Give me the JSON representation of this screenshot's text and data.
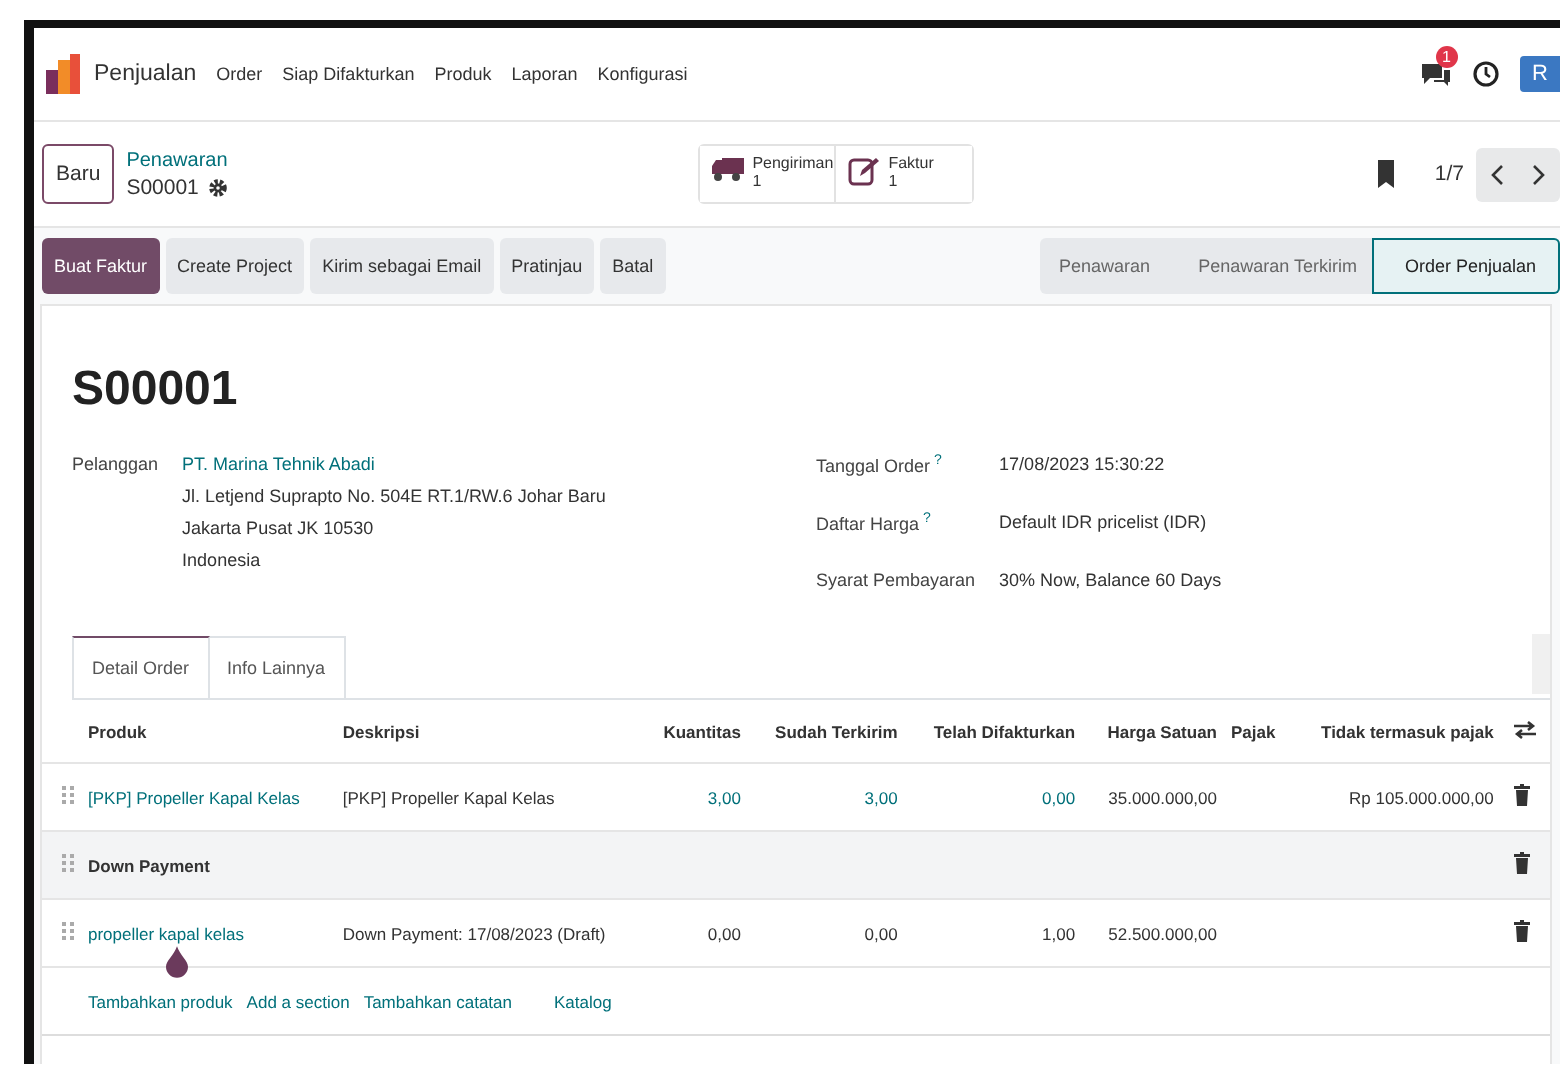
{
  "navbar": {
    "app_name": "Penjualan",
    "menu": [
      "Order",
      "Siap Difakturkan",
      "Produk",
      "Laporan",
      "Konfigurasi"
    ],
    "notification_count": "1",
    "avatar": "R"
  },
  "control_panel": {
    "new_button": "Baru",
    "breadcrumb": "Penawaran",
    "record": "S00001",
    "smart_buttons": [
      {
        "kind": "truck",
        "label": "Pengiriman",
        "count": "1"
      },
      {
        "kind": "invoice",
        "label": "Faktur",
        "count": "1"
      }
    ],
    "pager": "1/7"
  },
  "actions": [
    {
      "label": "Buat Faktur",
      "primary": true
    },
    {
      "label": "Create Project",
      "primary": false
    },
    {
      "label": "Kirim sebagai Email",
      "primary": false
    },
    {
      "label": "Pratinjau",
      "primary": false
    },
    {
      "label": "Batal",
      "primary": false
    }
  ],
  "stages": [
    {
      "label": "Penawaran",
      "selected": false
    },
    {
      "label": "Penawaran Terkirim",
      "selected": false
    },
    {
      "label": "Order Penjualan",
      "selected": true
    }
  ],
  "form": {
    "title": "S00001",
    "customer_label": "Pelanggan",
    "customer": "PT. Marina Tehnik Abadi",
    "address": [
      "Jl. Letjend Suprapto No. 504E RT.1/RW.6 Johar Baru",
      "Jakarta Pusat JK 10530",
      "Indonesia"
    ],
    "right_fields": [
      {
        "label": "Tanggal Order",
        "help": "?",
        "value": "17/08/2023 15:30:22"
      },
      {
        "label": "Daftar Harga",
        "help": "?",
        "value": "Default IDR pricelist (IDR)"
      },
      {
        "label": "Syarat Pembayaran",
        "value": "30% Now, Balance 60 Days"
      }
    ]
  },
  "tabs": [
    {
      "label": "Detail Order",
      "selected": true
    },
    {
      "label": "Info Lainnya",
      "selected": false
    }
  ],
  "table": {
    "columns": [
      "Produk",
      "Deskripsi",
      "Kuantitas",
      "Sudah Terkirim",
      "Telah Difakturkan",
      "Harga Satuan",
      "Pajak",
      "Tidak termasuk pajak"
    ],
    "rows": [
      {
        "kind": "line",
        "product": "[PKP] Propeller Kapal Kelas",
        "description": "[PKP] Propeller Kapal Kelas",
        "quantity": "3,00",
        "delivered": "3,00",
        "invoiced": "0,00",
        "quantities_linked": true,
        "unit_price": "35.000.000,00",
        "subtotal": "Rp 105.000.000,00"
      },
      {
        "kind": "section",
        "title": "Down Payment"
      },
      {
        "kind": "line",
        "product": "propeller kapal kelas",
        "description": "Down Payment: 17/08/2023 (Draft)",
        "quantity": "0,00",
        "delivered": "0,00",
        "invoiced": "1,00",
        "quantities_linked": false,
        "unit_price": "52.500.000,00"
      }
    ],
    "add_links": [
      "Tambahkan produk",
      "Add a section",
      "Tambahkan catatan",
      "Katalog"
    ]
  }
}
